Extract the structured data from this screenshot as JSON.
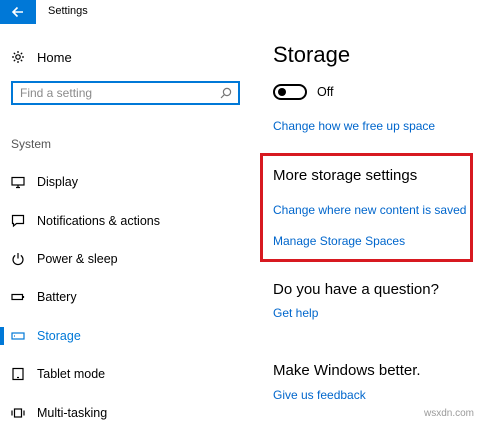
{
  "app": {
    "title": "Settings",
    "accent_color": "#0078d7",
    "back_icon": "arrow-left-icon"
  },
  "sidebar": {
    "home": {
      "label": "Home",
      "icon": "home-gear-icon"
    },
    "search": {
      "placeholder": "Find a setting",
      "value": "",
      "icon": "search-icon"
    },
    "section_label": "System",
    "items": [
      {
        "label": "Display",
        "icon": "monitor-icon",
        "selected": false
      },
      {
        "label": "Notifications & actions",
        "icon": "chat-bubble-icon",
        "selected": false
      },
      {
        "label": "Power & sleep",
        "icon": "power-icon",
        "selected": false
      },
      {
        "label": "Battery",
        "icon": "battery-icon",
        "selected": false
      },
      {
        "label": "Storage",
        "icon": "storage-drive-icon",
        "selected": true
      },
      {
        "label": "Tablet mode",
        "icon": "tablet-icon",
        "selected": false
      },
      {
        "label": "Multi-tasking",
        "icon": "multitask-icon",
        "selected": false
      }
    ]
  },
  "main": {
    "title": "Storage",
    "storage_sense": {
      "state_label": "Off",
      "enabled": false
    },
    "free_up_link": "Change how we free up space",
    "more_settings": {
      "heading": "More storage settings",
      "links": [
        "Change where new content is saved",
        "Manage Storage Spaces"
      ],
      "highlight_color": "#d71920"
    },
    "question": {
      "heading": "Do you have a question?",
      "link": "Get help"
    },
    "feedback": {
      "heading": "Make Windows better.",
      "link": "Give us feedback"
    }
  },
  "watermark": "wsxdn.com"
}
